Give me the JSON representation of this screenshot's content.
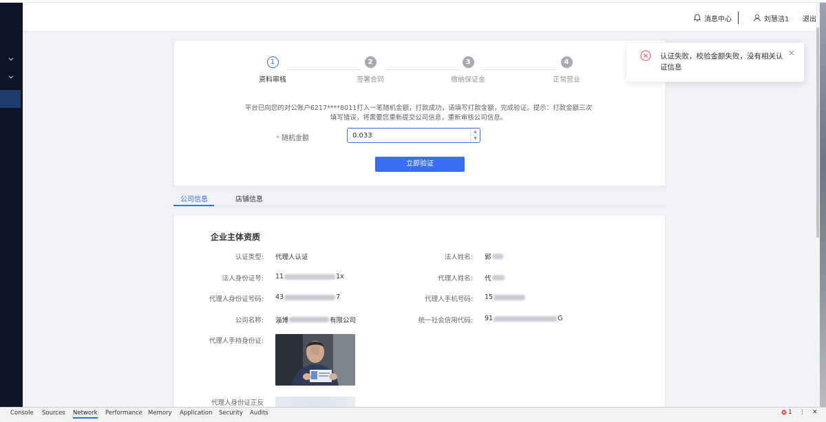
{
  "header": {
    "message_center": "消息中心",
    "user_name": "刘慧洁1",
    "logout": "退出"
  },
  "steps": [
    {
      "number": "1",
      "label": "资料审核",
      "state": "current"
    },
    {
      "number": "2",
      "label": "签署合同",
      "state": "pending"
    },
    {
      "number": "3",
      "label": "缴纳保证金",
      "state": "pending"
    },
    {
      "number": "4",
      "label": "正常营业",
      "state": "pending"
    }
  ],
  "verify": {
    "notice_line1": "平台已向您的对公账户6217****8011打入一笔随机金额，打款成功，请填写打款金额，完成验证。提示：打款金额三次",
    "notice_line2": "填写错误，将需要您重新提交公司信息，重新审核公司信息。",
    "amount_required_mark": "*",
    "amount_label": "随机金额",
    "amount_value": "0.033",
    "button_label": "立即验证"
  },
  "tabs": [
    {
      "label": "公司信息",
      "active": true
    },
    {
      "label": "店铺信息",
      "active": false
    }
  ],
  "company": {
    "section_title": "企业主体资质",
    "rows": [
      {
        "label": "认证类型:",
        "value": "代理人认证"
      },
      {
        "label": "法人姓名:",
        "value": "郭"
      },
      {
        "label": "法人身份证号:",
        "value_prefix": "11",
        "value_suffix": "1x"
      },
      {
        "label": "代理人姓名:",
        "value": "代"
      },
      {
        "label": "代理人身份证号码:",
        "value_prefix": "43",
        "value_suffix": "7"
      },
      {
        "label": "代理人手机号码:",
        "value": "15"
      },
      {
        "label": "公司名称:",
        "value_prefix": "淄博",
        "value_suffix": "有限公司"
      },
      {
        "label": "统一社会信用代码:",
        "value_prefix": "91",
        "value_suffix": "G"
      },
      {
        "label": "代理人手持身份证:"
      },
      {
        "label": "代理人身份证正反"
      }
    ]
  },
  "toast": {
    "message": "认证失败，校验金额失败，没有相关认证信息",
    "type": "error",
    "icon": "error-circle-icon",
    "color": "#f56c6c"
  },
  "devtools": {
    "tabs": [
      "Console",
      "Sources",
      "Network",
      "Performance",
      "Memory",
      "Application",
      "Security",
      "Audits"
    ],
    "active_tab": "Network",
    "error_count": "1"
  },
  "colors": {
    "primary": "#3a6cf4",
    "sidebar": "#0c1425",
    "error": "#f56c6c"
  }
}
